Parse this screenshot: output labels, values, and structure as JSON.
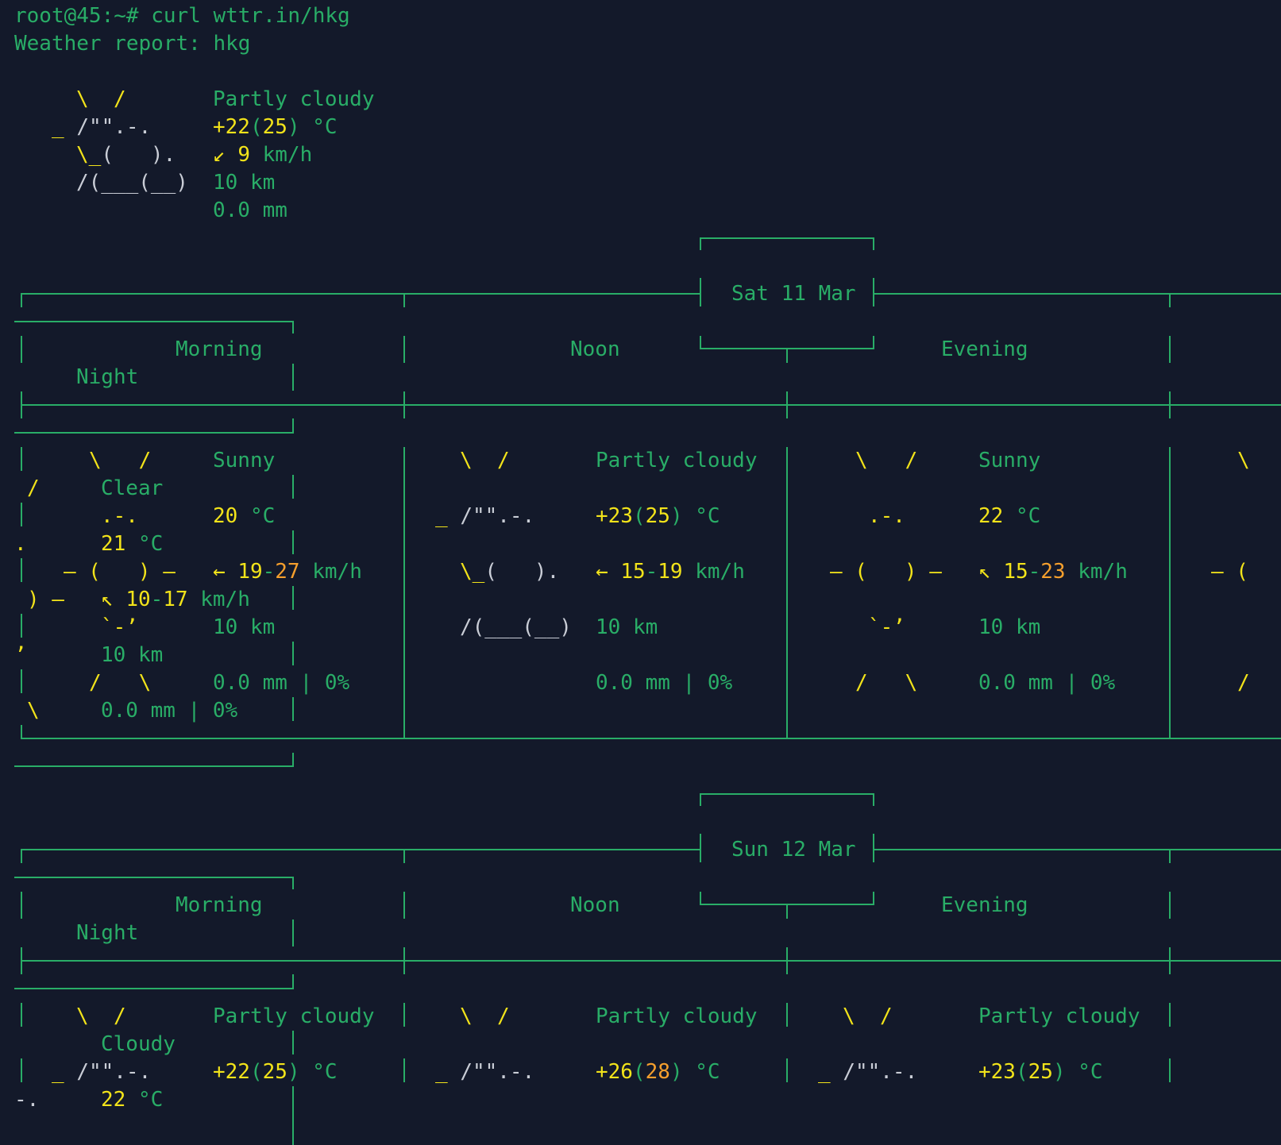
{
  "terminal": {
    "prompt": "root@45:~#",
    "command": "curl wttr.in/hkg",
    "report_header": "Weather report: hkg"
  },
  "current": {
    "art": [
      "\\  /",
      "_ /\"\".-.",
      "\\_(   ).",
      "/(___(__)"
    ],
    "condition": "Partly cloudy",
    "temp": "+22",
    "feels": "25",
    "temp_unit": "°C",
    "wind_arrow": "↙",
    "wind": "9",
    "wind_unit": "km/h",
    "visibility": "10 km",
    "precip": "0.0 mm"
  },
  "days": [
    {
      "date": "Sat 11 Mar",
      "periods": {
        "morning": "Morning",
        "noon": "Noon",
        "evening": "Evening",
        "night": "Night"
      },
      "morning": {
        "condition": "Sunny",
        "temp": "20",
        "temp_unit": "°C",
        "wind_arrow": "←",
        "wind_low": "19",
        "wind_high": "27",
        "wind_unit": "km/h",
        "visibility": "10 km",
        "precip": "0.0 mm | 0%"
      },
      "night": {
        "condition": "Clear",
        "temp": "21",
        "temp_unit": "°C",
        "wind_arrow": "↖",
        "wind_low": "10",
        "wind_high": "17",
        "wind_unit": "km/h",
        "visibility": "10 km",
        "precip": "0.0 mm | 0%"
      },
      "noon": {
        "condition": "Partly cloudy",
        "temp": "+23",
        "feels": "25",
        "temp_unit": "°C",
        "wind_arrow": "←",
        "wind_low": "15",
        "wind_high": "19",
        "wind_unit": "km/h",
        "visibility": "10 km",
        "precip": "0.0 mm | 0%"
      },
      "evening": {
        "condition": "Sunny",
        "temp": "22",
        "temp_unit": "°C",
        "wind_arrow": "↖",
        "wind_low": "15",
        "wind_high": "23",
        "wind_unit": "km/h",
        "visibility": "10 km",
        "precip": "0.0 mm | 0%"
      }
    },
    {
      "date": "Sun 12 Mar",
      "periods": {
        "morning": "Morning",
        "noon": "Noon",
        "evening": "Evening",
        "night": "Night"
      },
      "morning": {
        "condition": "Partly cloudy",
        "temp": "+22",
        "feels": "25",
        "temp_unit": "°C"
      },
      "night": {
        "condition": "Cloudy",
        "temp": "22",
        "temp_unit": "°C"
      },
      "noon": {
        "condition": "Partly cloudy",
        "temp": "+26",
        "feels": "28",
        "temp_unit": "°C"
      },
      "evening": {
        "condition": "Partly cloudy",
        "temp": "+23",
        "feels": "25",
        "temp_unit": "°C"
      }
    }
  ],
  "colors": {
    "background": "#13192a",
    "text_green": "#29ad67",
    "sun_yellow": "#f2e31a",
    "warm_orange": "#f59f2d",
    "cloud_white": "#c9cdd6"
  }
}
